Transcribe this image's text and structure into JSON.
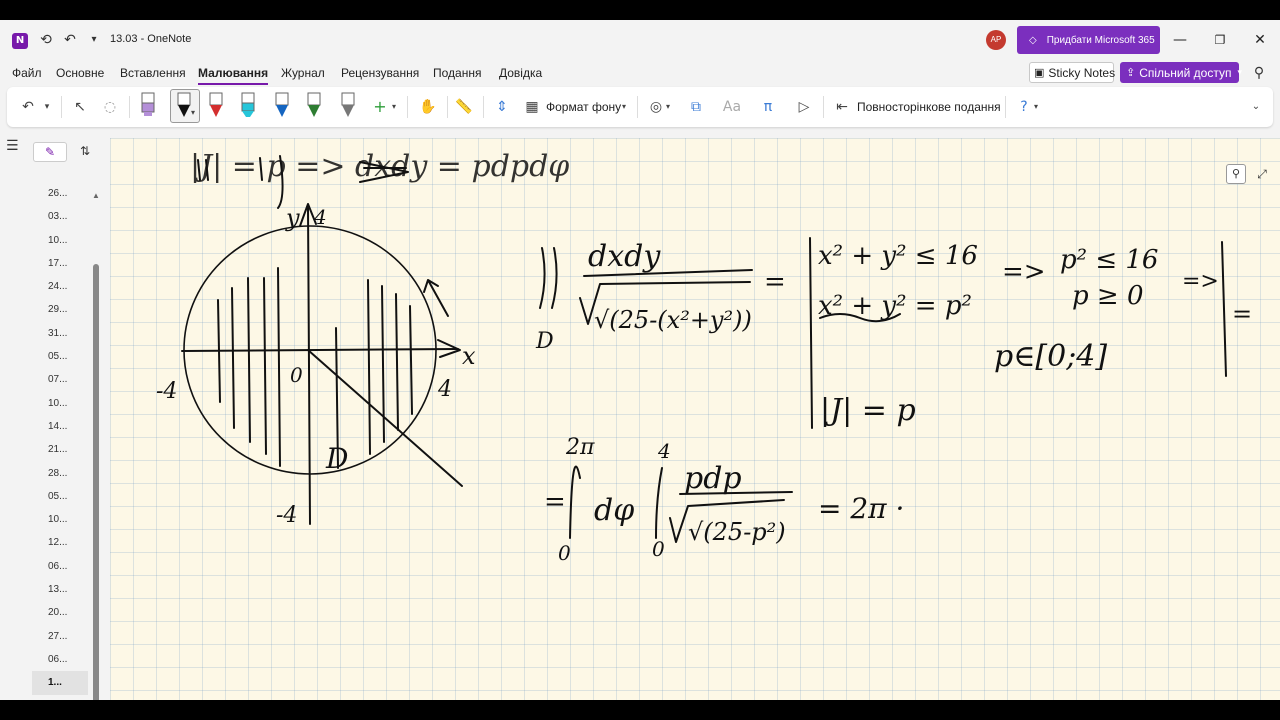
{
  "app": {
    "logo": "N",
    "title": "13.03  -  OneNote",
    "avatar_initials": "AP",
    "m365_label": "Придбати Microsoft 365"
  },
  "tabs": [
    "Файл",
    "Основне",
    "Вставлення",
    "Малювання",
    "Журнал",
    "Рецензування",
    "Подання",
    "Довідка"
  ],
  "active_tab": "Малювання",
  "header": {
    "sticky_label": "Sticky Notes",
    "share_label": "Спільний доступ"
  },
  "toolbar": {
    "background_format_label": "Формат фону",
    "full_page_view_label": "Повносторінкове подання",
    "pen_colors": [
      "#b48fd8",
      "#111111",
      "#d32f2f",
      "#26c6da",
      "#1565c0",
      "#2e7d32",
      "#777777"
    ],
    "add_symbol": "+"
  },
  "nav": {
    "pages": [
      "26...",
      "03...",
      "10...",
      "17...",
      "24...",
      "29...",
      "31...",
      "05...",
      "07...",
      "10...",
      "14...",
      "21...",
      "28...",
      "05...",
      "10...",
      "12...",
      "06...",
      "13...",
      "20...",
      "27...",
      "06...",
      "1..."
    ],
    "selected_index": 21
  },
  "colors": {
    "accent": "#7719aa",
    "m365_purple": "#7b2fbe",
    "ink": "#111111"
  },
  "ink": {
    "top_line": "|J| = p  =>  dxdy = pdpdφ",
    "axis_y": "y",
    "axis_y_num": "4",
    "axis_x": "x",
    "label_4": "4",
    "label_neg4_x": "-4",
    "label_neg4_y": "-4",
    "origin": "0",
    "region": "D",
    "integral_lhs_num": "dxdy",
    "integral_lhs_den": "√(25-(x²+y²))",
    "integral_sub": "D",
    "equals": "=",
    "sys1": "x² + y² ≤ 16",
    "sys2": "x² + y² = p²",
    "cond1": "p² ≤ 16",
    "cond2": "p ≥ 0",
    "implies": "=>",
    "p_range": "p∈[0;4]",
    "jacobian": "|J| = p",
    "int2_upper": "2π",
    "int2_lower": "0",
    "int2_dphi": "dφ",
    "int3_upper": "4",
    "int3_lower": "0",
    "int3_num": "pdp",
    "int3_den": "√(25-p²)",
    "result": "= 2π ·"
  }
}
